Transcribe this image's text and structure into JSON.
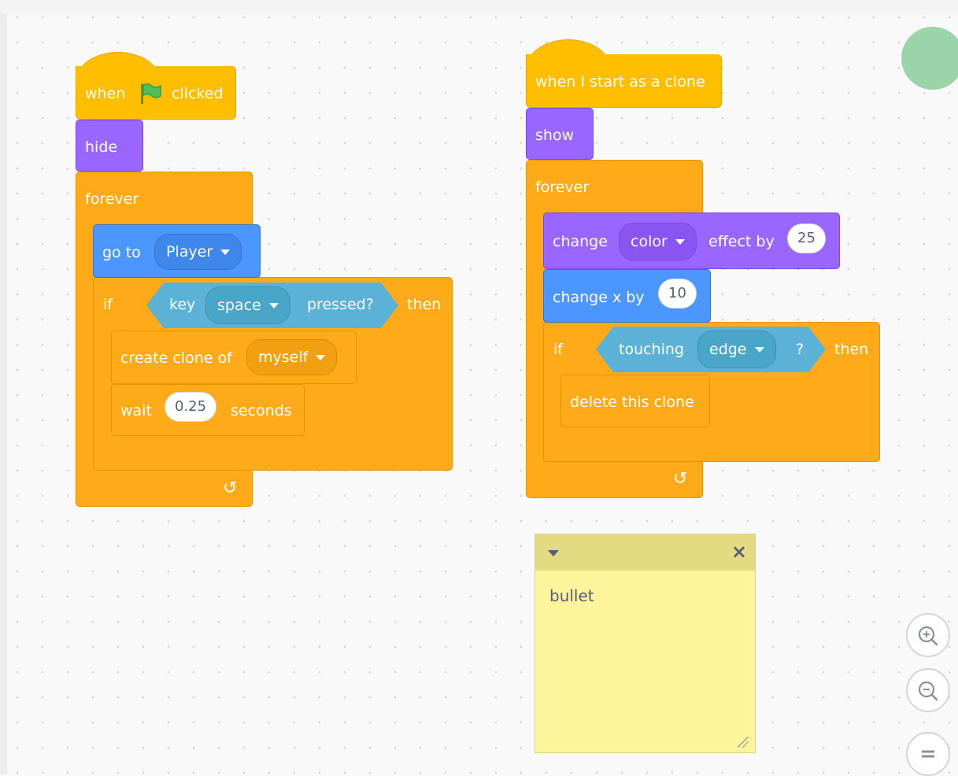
{
  "script1": {
    "hat": {
      "when": "when",
      "flag_icon": "green-flag-icon",
      "clicked": "clicked"
    },
    "hide": "hide",
    "forever": "forever",
    "goto": {
      "label": "go to",
      "target": "Player"
    },
    "if_block": {
      "if": "if",
      "then": "then",
      "sensing": {
        "key": "key",
        "key_value": "space",
        "pressed": "pressed?"
      }
    },
    "create_clone": {
      "label": "create clone of",
      "target": "myself"
    },
    "wait": {
      "label": "wait",
      "value": "0.25",
      "unit": "seconds"
    },
    "loop_icon": "↺"
  },
  "script2": {
    "hat": "when I start as a clone",
    "show": "show",
    "forever": "forever",
    "change_effect": {
      "change": "change",
      "effect": "color",
      "effect_by": "effect by",
      "value": "25"
    },
    "change_x": {
      "label": "change x by",
      "value": "10"
    },
    "if_block": {
      "if": "if",
      "then": "then",
      "sensing": {
        "touching": "touching",
        "target": "edge",
        "q": "?"
      }
    },
    "delete_clone": "delete this clone",
    "loop_icon": "↺"
  },
  "note": {
    "text": "bullet",
    "close": "×"
  },
  "zoom": {
    "in": "zoom-in-icon",
    "out": "zoom-out-icon",
    "reset": "zoom-reset-icon",
    "reset_label": "="
  },
  "colors": {
    "events": "#ffbf00",
    "control": "#ffab19",
    "looks": "#9966ff",
    "motion": "#4c97ff",
    "sensing": "#5cb1d6",
    "note": "#fef49c"
  }
}
